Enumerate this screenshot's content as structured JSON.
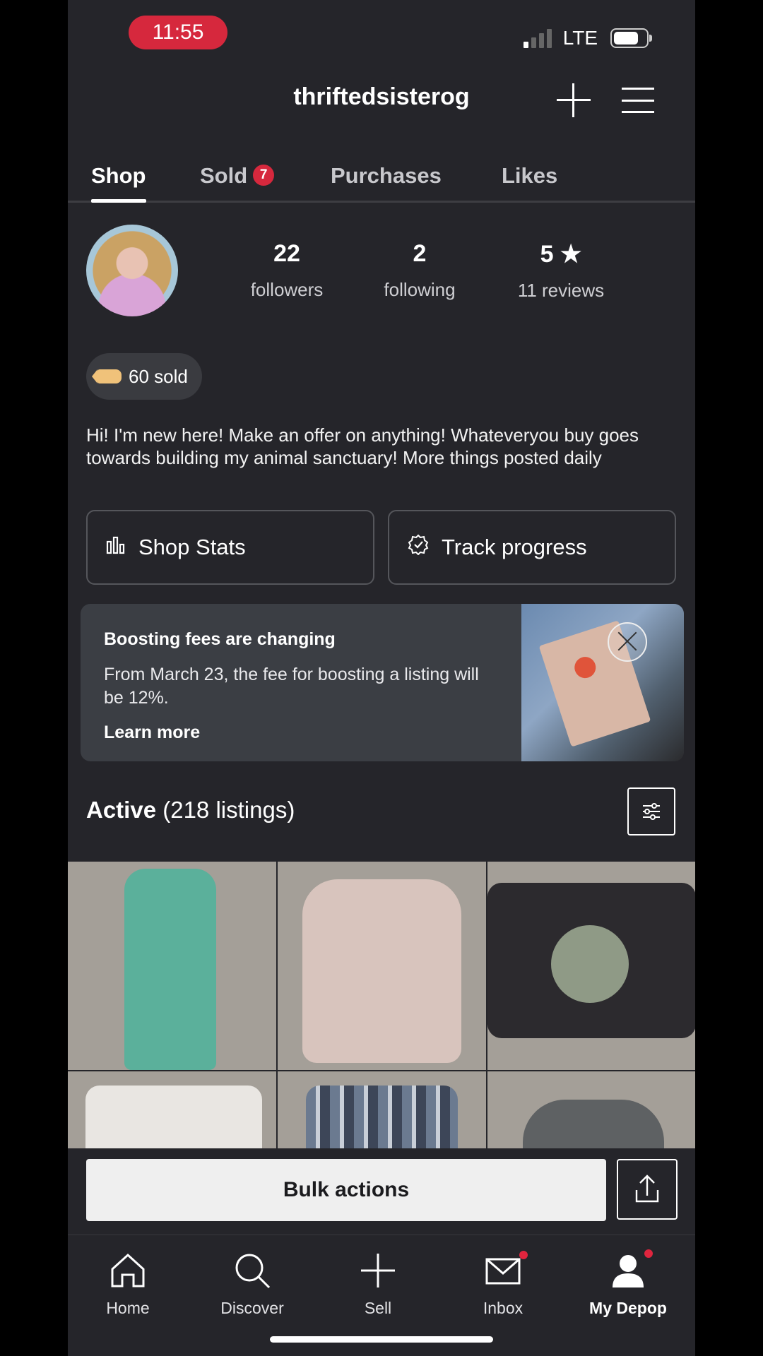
{
  "status_bar": {
    "time": "11:55",
    "network": "LTE"
  },
  "header": {
    "username": "thriftedsisterog"
  },
  "tabs": [
    {
      "label": "Shop",
      "active": true
    },
    {
      "label": "Sold",
      "badge": "7"
    },
    {
      "label": "Purchases"
    },
    {
      "label": "Likes"
    }
  ],
  "profile": {
    "followers_count": "22",
    "followers_label": "followers",
    "following_count": "2",
    "following_label": "following",
    "rating": "5 ★",
    "reviews_label": "11 reviews",
    "sold_label": "60 sold",
    "bio": "Hi! I'm new here! Make an offer on anything! Whateveryou buy goes towards building my animal sanctuary! More things posted daily"
  },
  "actions": {
    "shop_stats": "Shop Stats",
    "track_progress": "Track progress"
  },
  "banner": {
    "title": "Boosting fees are changing",
    "text": "From March 23, the fee for boosting a listing will be 12%.",
    "link": "Learn more"
  },
  "listings": {
    "heading": "Active",
    "count_text": "(218 listings)"
  },
  "bulk": {
    "label": "Bulk actions"
  },
  "nav": [
    {
      "label": "Home",
      "icon": "home-icon"
    },
    {
      "label": "Discover",
      "icon": "search-icon"
    },
    {
      "label": "Sell",
      "icon": "plus-icon"
    },
    {
      "label": "Inbox",
      "icon": "mail-icon"
    },
    {
      "label": "My Depop",
      "icon": "person-icon",
      "active": true
    }
  ],
  "colors": {
    "accent_red": "#d6283d",
    "background": "#25252a",
    "banner_bg": "#3b3e44"
  }
}
